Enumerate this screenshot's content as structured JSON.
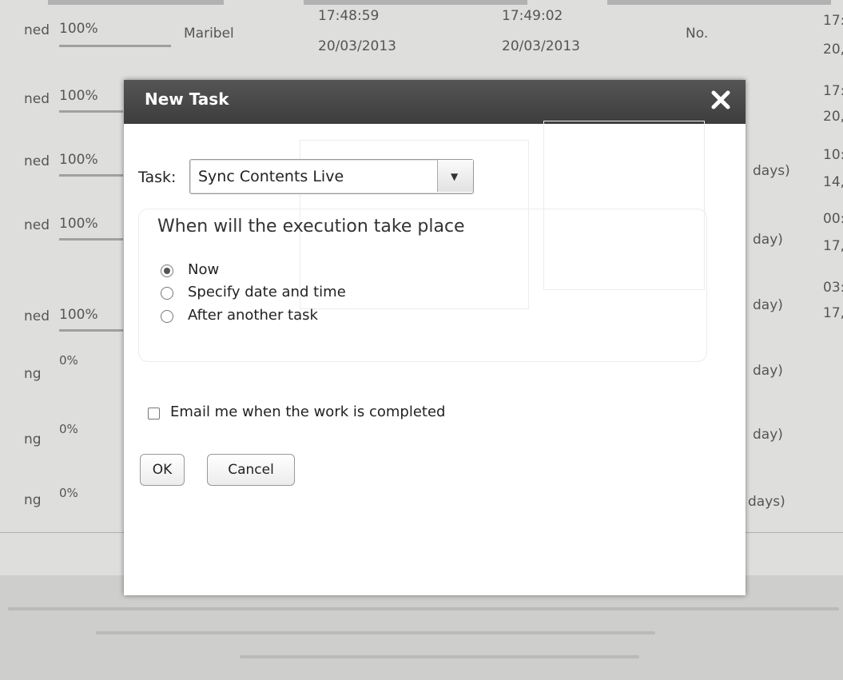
{
  "background": {
    "rows": [
      {
        "status": "ned",
        "percent": "100%",
        "user": "Maribel",
        "start_time": "17:48:59",
        "start_date": "20/03/2013",
        "end_time": "17:49:02",
        "end_date": "20/03/2013",
        "recurrence": "No.",
        "next_time": "17:",
        "next_date": "20,",
        "progress": 1.0
      },
      {
        "status": "ned",
        "percent": "100%",
        "user": "",
        "recurrence": "",
        "next_time": "17:",
        "next_date": "20,",
        "progress": 1.0
      },
      {
        "status": "ned",
        "percent": "100%",
        "user": "",
        "recurrence": "days)",
        "next_time": "10:",
        "next_date": "14,",
        "progress": 1.0
      },
      {
        "status": "ned",
        "percent": "100%",
        "user": "",
        "recurrence": "day)",
        "next_time": "00:",
        "next_date": "17,",
        "progress": 1.0
      },
      {
        "status": "ned",
        "percent": "100%",
        "user": "",
        "recurrence": "day)",
        "next_time": "03:",
        "next_date": "17,",
        "progress": 1.0
      },
      {
        "status": "ng",
        "percent": "0%",
        "user": "",
        "recurrence": "day)",
        "next_time": "",
        "next_date": "",
        "progress": 0
      },
      {
        "status": "ng",
        "percent": "0%",
        "user": "",
        "recurrence": "day)",
        "next_time": "",
        "next_date": "",
        "progress": 0
      },
      {
        "status": "ng",
        "percent": "0%",
        "user": "",
        "recurrence": "days)",
        "next_time": "",
        "next_date": "",
        "progress": 0
      }
    ]
  },
  "dialog": {
    "title": "New Task",
    "close_icon": "close-icon",
    "task_label": "Task:",
    "task_value": "Sync Contents Live",
    "dropdown_icon": "chevron-down-icon",
    "when_title": "When will the execution take place",
    "options": [
      {
        "label": "Now",
        "selected": true
      },
      {
        "label": "Specify date and time",
        "selected": false
      },
      {
        "label": "After another task",
        "selected": false
      }
    ],
    "email_label": "Email me when the work is completed",
    "email_checked": false,
    "ok_label": "OK",
    "cancel_label": "Cancel"
  },
  "colors": {
    "titlebar": "#474747",
    "title_text": "#ffffff",
    "page_background": "#eeeeec"
  }
}
